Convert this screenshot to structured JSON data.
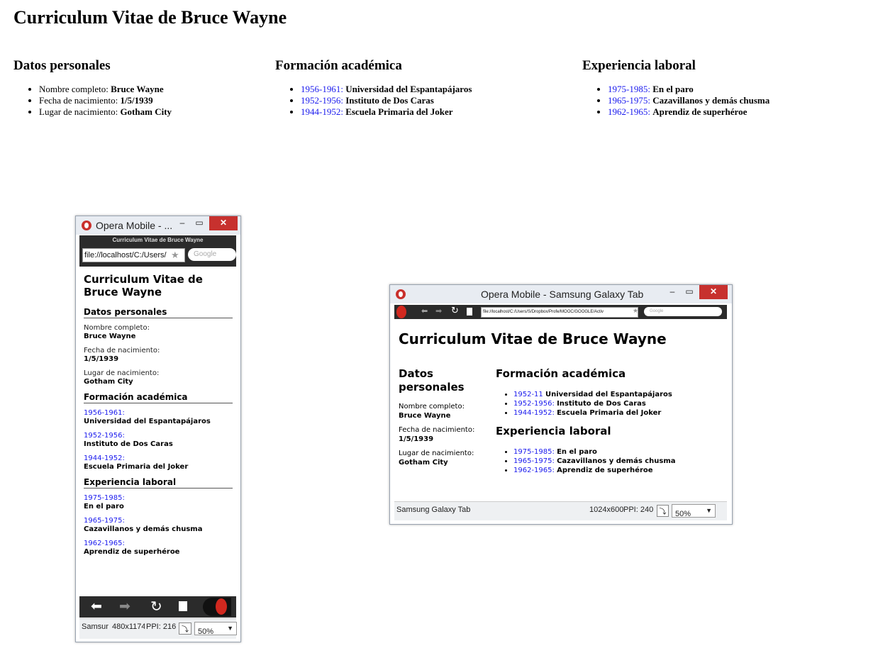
{
  "page": {
    "title": "Curriculum Vitae de Bruce Wayne",
    "sections": {
      "personal": {
        "heading": "Datos personales",
        "items": [
          {
            "label": "Nombre completo:",
            "value": "Bruce Wayne"
          },
          {
            "label": "Fecha de nacimiento:",
            "value": "1/5/1939"
          },
          {
            "label": "Lugar de nacimiento:",
            "value": "Gotham City"
          }
        ]
      },
      "education": {
        "heading": "Formación académica",
        "items": [
          {
            "years": "1956-1961:",
            "value": "Universidad del Espantapájaros"
          },
          {
            "years": "1952-1956:",
            "value": "Instituto de Dos Caras"
          },
          {
            "years": "1944-1952:",
            "value": "Escuela Primaria del Joker"
          }
        ]
      },
      "work": {
        "heading": "Experiencia laboral",
        "items": [
          {
            "years": "1975-1985:",
            "value": "En el paro"
          },
          {
            "years": "1965-1975:",
            "value": "Cazavillanos y demás chusma"
          },
          {
            "years": "1962-1965:",
            "value": "Aprendiz de superhéroe"
          }
        ]
      }
    }
  },
  "phone": {
    "window_title": "Opera Mobile - ...",
    "tab_title": "Curriculum Vitae de Bruce Wayne",
    "url": "file://localhost/C:/Users/",
    "search_placeholder": "Google",
    "content_title": "Curriculum Vitae de Bruce Wayne",
    "status_device": "Samsung",
    "status_resolution": "480x1174",
    "status_ppi": "PPI: 216",
    "zoom": "50%"
  },
  "tablet": {
    "window_title": "Opera Mobile - Samsung Galaxy Tab",
    "url": "file://localhost/C:/Users/S/Dropbox/Profe/MOOC/GOOGLE/Activ",
    "search_placeholder": "Google",
    "content_title": "Curriculum Vitae de Bruce Wayne",
    "personal_heading": "Datos personales",
    "education_heading": "Formación académica",
    "work_heading": "Experiencia laboral",
    "education_items": [
      {
        "years": "1952-11",
        "value": "Universidad del Espantapájaros"
      },
      {
        "years": "1952-1956:",
        "value": "Instituto de Dos Caras"
      },
      {
        "years": "1944-1952:",
        "value": "Escuela Primaria del Joker"
      }
    ],
    "work_items": [
      {
        "years": "1975-1985:",
        "value": "En el paro"
      },
      {
        "years": "1965-1975:",
        "value": "Cazavillanos y demás chusma"
      },
      {
        "years": "1962-1965:",
        "value": "Aprendiz de superhéroe"
      }
    ],
    "status_device": "Samsung Galaxy Tab",
    "status_resolution": "1024x600",
    "status_ppi": "PPI: 240",
    "zoom": "50%"
  }
}
